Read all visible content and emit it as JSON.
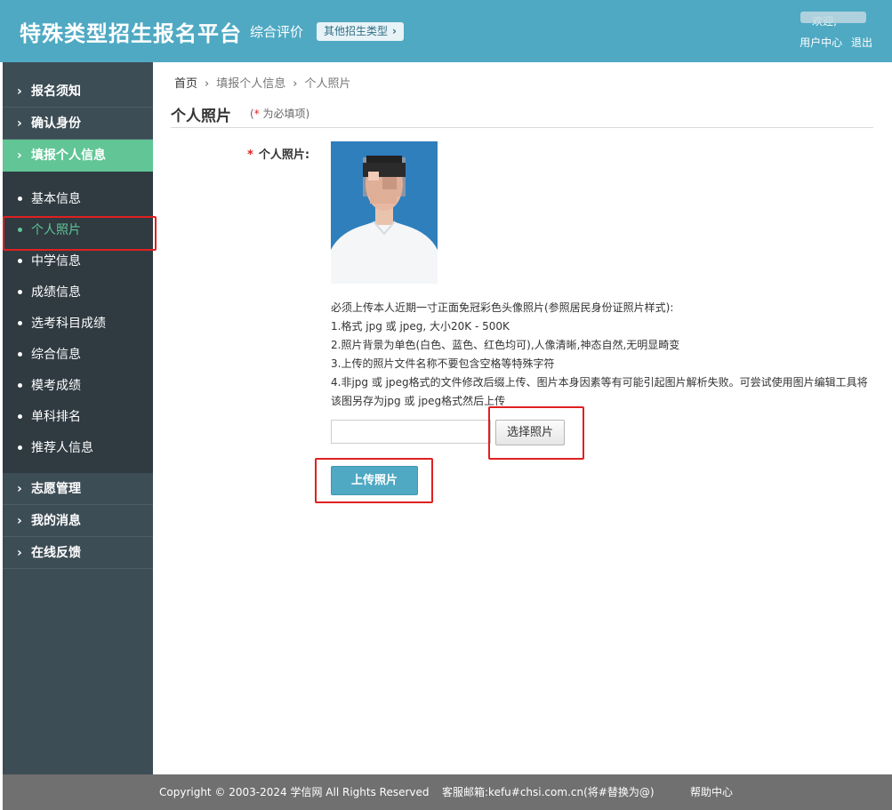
{
  "header": {
    "site_title": "特殊类型招生报名平台",
    "eval_label": "综合评价",
    "other_types_label": "其他招生类型",
    "welcome": "欢迎,",
    "user_center": "用户中心",
    "logout": "退出"
  },
  "sidebar": {
    "items_top": [
      {
        "label": "报名须知"
      },
      {
        "label": "确认身份"
      },
      {
        "label": "填报个人信息"
      }
    ],
    "sub_items": [
      {
        "label": "基本信息"
      },
      {
        "label": "个人照片"
      },
      {
        "label": "中学信息"
      },
      {
        "label": "成绩信息"
      },
      {
        "label": "选考科目成绩"
      },
      {
        "label": "综合信息"
      },
      {
        "label": "模考成绩"
      },
      {
        "label": "单科排名"
      },
      {
        "label": "推荐人信息"
      }
    ],
    "items_bottom": [
      {
        "label": "志愿管理"
      },
      {
        "label": "我的消息"
      },
      {
        "label": "在线反馈"
      }
    ]
  },
  "breadcrumb": {
    "home": "首页",
    "level2": "填报个人信息",
    "current": "个人照片"
  },
  "page": {
    "title": "个人照片",
    "required_star": "*",
    "required_text": "为必填项",
    "field_star": "*",
    "field_label": "个人照片:"
  },
  "instructions": {
    "intro": "必须上传本人近期一寸正面免冠彩色头像照片(参照居民身份证照片样式):",
    "rule1": "1.格式 jpg 或 jpeg, 大小20K - 500K",
    "rule2": "2.照片背景为单色(白色、蓝色、红色均可),人像清晰,神态自然,无明显畸变",
    "rule3": "3.上传的照片文件名称不要包含空格等特殊字符",
    "rule4": "4.非jpg 或 jpeg格式的文件修改后缀上传、图片本身因素等有可能引起图片解析失败。可尝试使用图片编辑工具将该图另存为jpg 或 jpeg格式然后上传"
  },
  "actions": {
    "choose_photo": "选择照片",
    "upload_photo": "上传照片"
  },
  "footer": {
    "copyright": "Copyright © 2003-2024 学信网 All Rights Reserved",
    "service_email": "客服邮箱:kefu#chsi.com.cn(将#替换为@)",
    "help_center": "帮助中心"
  },
  "colors": {
    "header_bg": "#4fa9c3",
    "sidebar_bg": "#3d4d56",
    "active_green": "#61c596",
    "highlight_red": "#e02020"
  }
}
